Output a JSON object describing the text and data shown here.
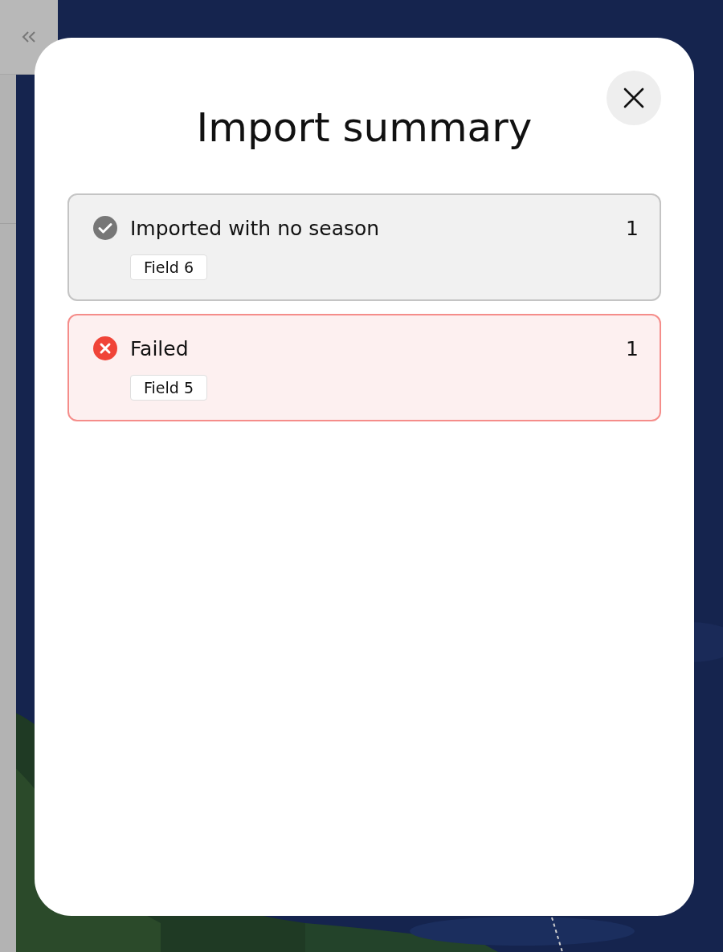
{
  "modal": {
    "title": "Import summary",
    "groups": [
      {
        "kind": "success",
        "label": "Imported with no season",
        "count": "1",
        "fields": [
          "Field 6"
        ]
      },
      {
        "kind": "error",
        "label": "Failed",
        "count": "1",
        "fields": [
          "Field 5"
        ]
      }
    ]
  }
}
